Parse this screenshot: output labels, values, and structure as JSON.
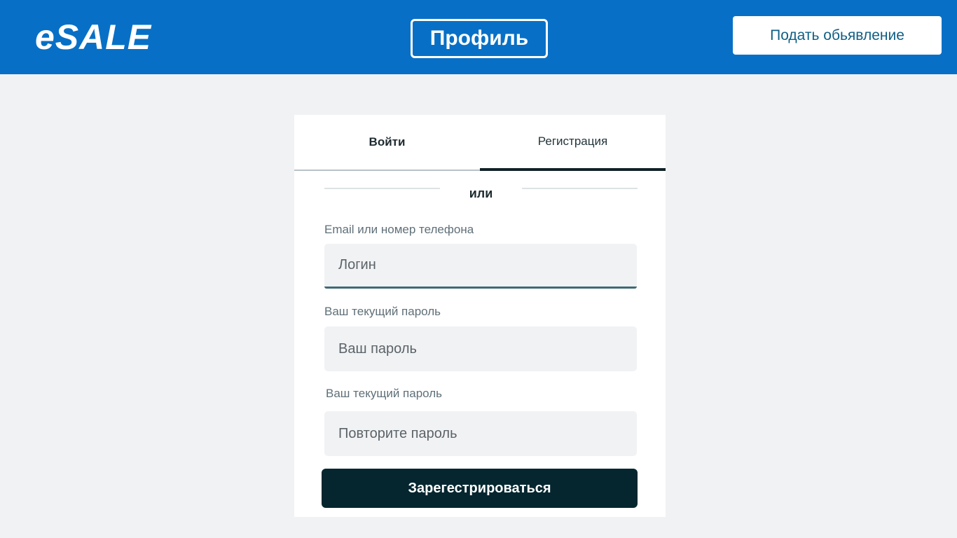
{
  "header": {
    "logo": "eSALE",
    "profile_label": "Профиль",
    "post_ad_label": "Подать обьявление"
  },
  "auth": {
    "tabs": [
      {
        "label": "Войти"
      },
      {
        "label": "Регистрация"
      }
    ],
    "or_label": "или",
    "fields": {
      "login_label": "Email или номер телефона",
      "login_placeholder": "Логин",
      "password_label": "Ваш текущий пароль",
      "password_placeholder": "Ваш пароль",
      "repeat_label": "Ваш текущий пароль",
      "repeat_placeholder": "Повторите пароль"
    },
    "submit_label": "Зарегестрироваться"
  },
  "colors": {
    "header_bg": "#0770c6",
    "page_bg": "#f1f2f4",
    "button_dark": "#05262f",
    "post_ad_text": "#0f5f86"
  }
}
